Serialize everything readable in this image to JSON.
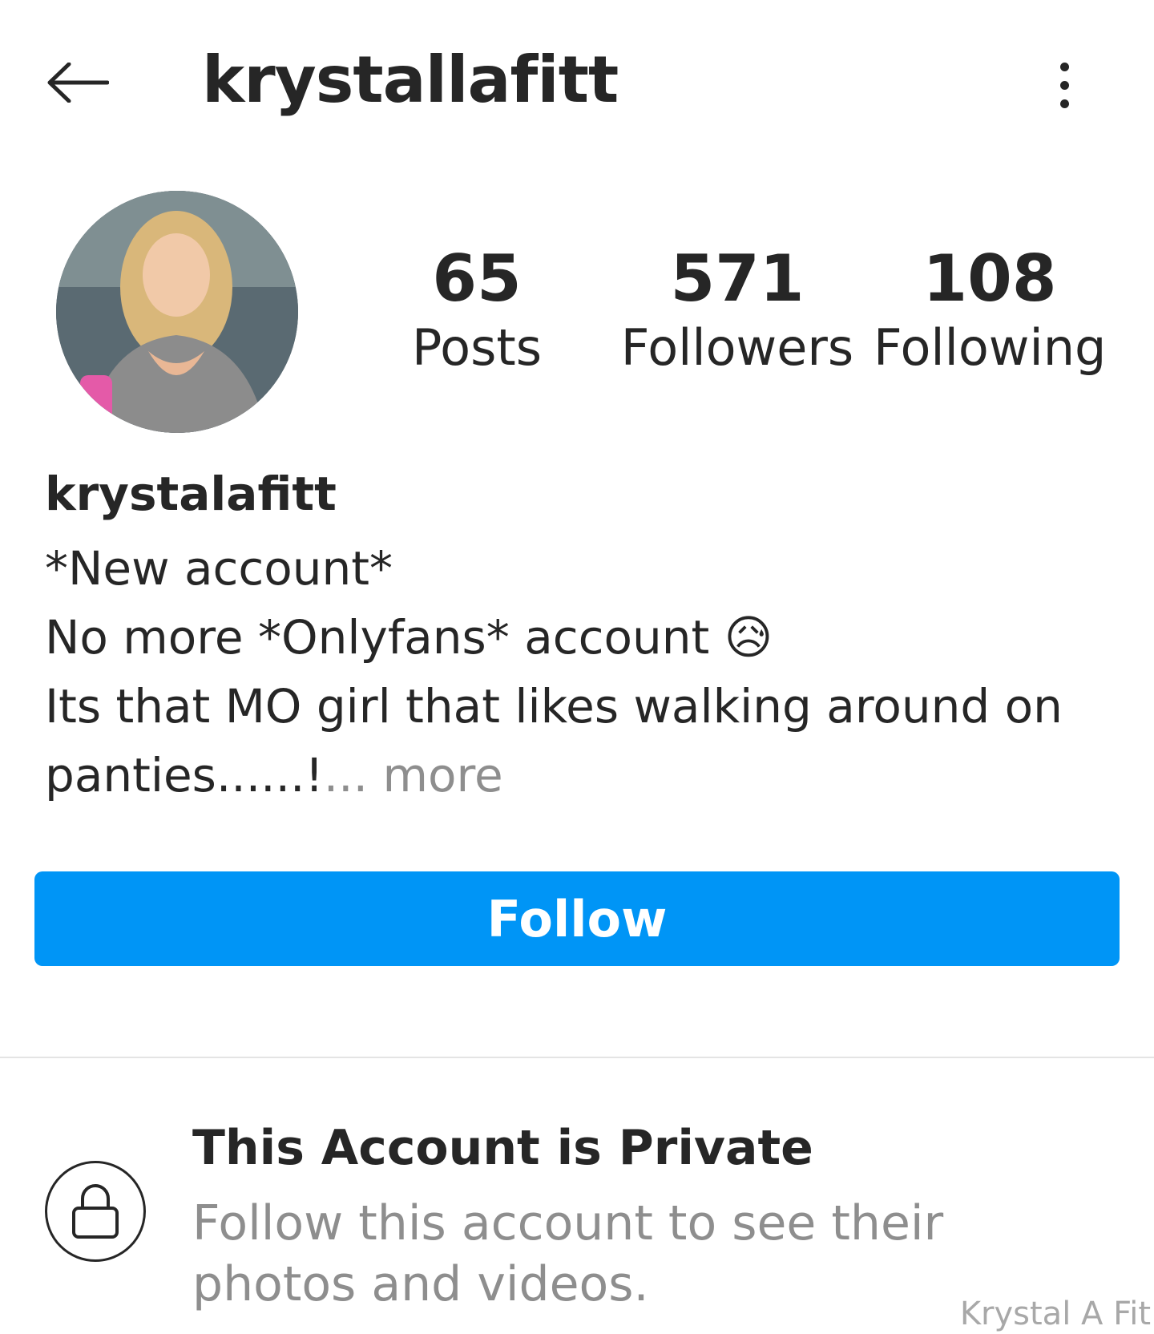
{
  "header": {
    "title": "krystallafitt",
    "back_icon": "arrow-left-icon",
    "menu_icon": "more-vertical-icon"
  },
  "profile": {
    "avatar_icon": "profile-photo",
    "stats": {
      "posts": {
        "value": "65",
        "label": "Posts"
      },
      "followers": {
        "value": "571",
        "label": "Followers"
      },
      "following": {
        "value": "108",
        "label": "Following"
      }
    },
    "bio": {
      "name": "krystalafitt",
      "line1": "*New account*",
      "line2": "No more *Onlyfans* account",
      "line2_emoji": "😥",
      "line3": "Its that MO girl that likes walking around on",
      "line4": "panties......!",
      "ellipsis": "...",
      "more": "more"
    }
  },
  "follow_button": {
    "label": "Follow",
    "color": "#0095f6"
  },
  "private_notice": {
    "lock_icon": "lock-icon",
    "title": "This Account is Private",
    "text": "Follow this account to see their photos and videos."
  },
  "watermark": "Krystal A Fit"
}
